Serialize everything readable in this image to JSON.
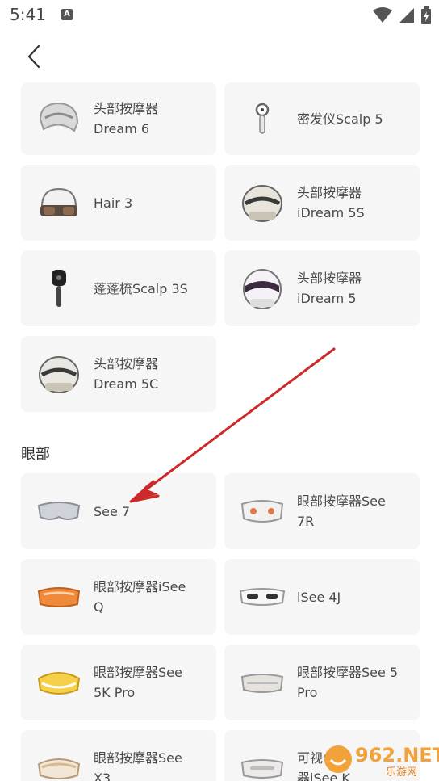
{
  "status": {
    "time": "5:41",
    "notif": "A"
  },
  "accent_red": "#cc2a2a",
  "items_top": [
    {
      "line1": "头部按摩器",
      "line2": "Dream 6",
      "icon": "helmet-icon"
    },
    {
      "line1": "密发仪Scalp 5",
      "line2": "",
      "icon": "scalp-device-icon"
    },
    {
      "line1": "Hair 3",
      "line2": "",
      "icon": "helmet-glasses-icon"
    },
    {
      "line1": "头部按摩器",
      "line2": "iDream 5S",
      "icon": "helmet-icon"
    },
    {
      "line1": "蓬蓬梳Scalp 3S",
      "line2": "",
      "icon": "comb-icon"
    },
    {
      "line1": "头部按摩器",
      "line2": "iDream 5",
      "icon": "helmet-icon"
    },
    {
      "line1": "头部按摩器",
      "line2": "Dream 5C",
      "icon": "helmet-icon"
    }
  ],
  "section": {
    "title": "眼部"
  },
  "items_eye": [
    {
      "line1": "See 7",
      "line2": "",
      "icon": "eye-mask-gray-icon"
    },
    {
      "line1": "眼部按摩器See",
      "line2": "7R",
      "icon": "eye-mask-white-icon"
    },
    {
      "line1": "眼部按摩器iSee",
      "line2": "Q",
      "icon": "eye-mask-orange-icon"
    },
    {
      "line1": "iSee 4J",
      "line2": "",
      "icon": "eye-mask-white-icon"
    },
    {
      "line1": "眼部按摩器See",
      "line2": "5K Pro",
      "icon": "eye-mask-yellow-icon"
    },
    {
      "line1": "眼部按摩器See 5",
      "line2": "Pro",
      "icon": "eye-mask-silver-icon"
    },
    {
      "line1": "眼部按摩器See",
      "line2": "X3",
      "icon": "eye-mask-beige-icon"
    },
    {
      "line1": "可视化",
      "line2": "器iSee K",
      "icon": "eye-mask-silver-icon"
    }
  ],
  "watermark": {
    "text": "962.NET",
    "sub": "乐游网"
  }
}
